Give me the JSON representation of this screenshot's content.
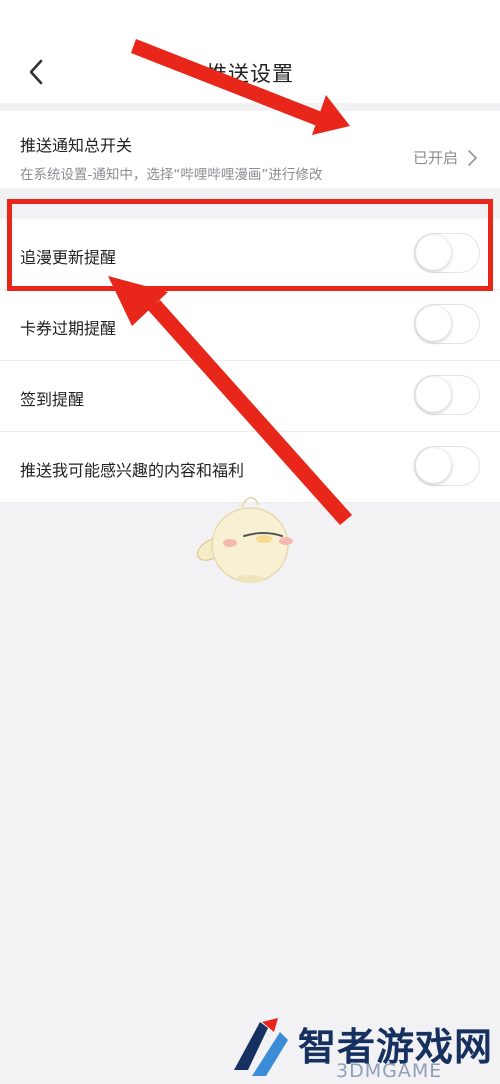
{
  "header": {
    "back_icon": "chevron-left-icon",
    "title": "推送设置"
  },
  "master_switch": {
    "title": "推送通知总开关",
    "subtitle": "在系统设置-通知中，选择“哔哩哔哩漫画”进行修改",
    "status": "已开启",
    "arrow_icon": "chevron-right-icon"
  },
  "settings": [
    {
      "label": "追漫更新提醒",
      "on": false
    },
    {
      "label": "卡券过期提醒",
      "on": false
    },
    {
      "label": "签到提醒",
      "on": false
    },
    {
      "label": "推送我可能感兴趣的内容和福利",
      "on": false
    }
  ],
  "watermark": {
    "text": "智者游戏网",
    "sub": "3DMGAME"
  },
  "colors": {
    "annotation_red": "#e8271a",
    "page_bg": "#f2f2f4",
    "watermark_blue": "#16315f"
  }
}
